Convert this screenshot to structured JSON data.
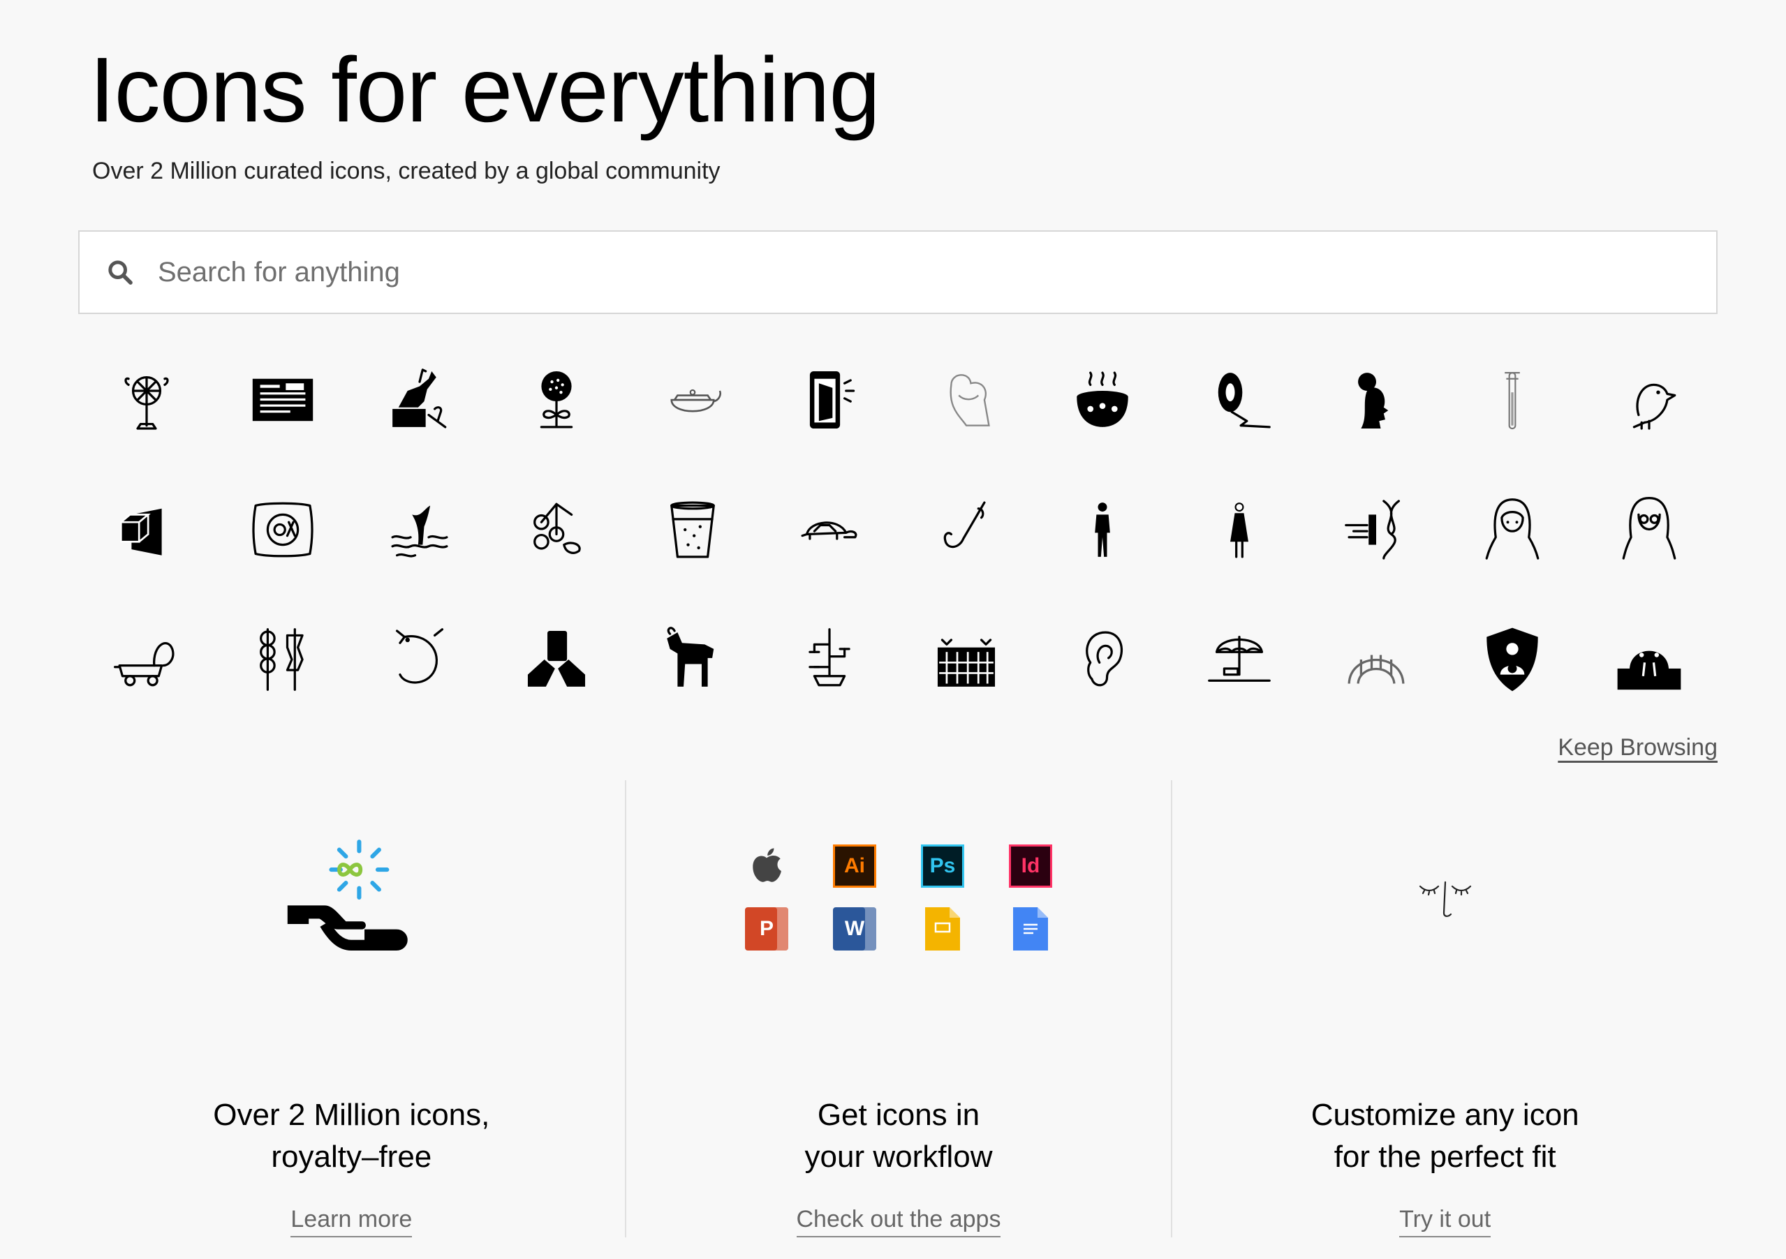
{
  "hero": {
    "title": "Icons for everything",
    "subtitle": "Over 2 Million curated icons, created by a global community"
  },
  "search": {
    "placeholder": "Search for anything",
    "icon": "search-icon"
  },
  "icon_grid": [
    "fan-icon",
    "newspaper-icon",
    "equestrian-statue-icon",
    "sunflower-icon",
    "teapot-icon",
    "phone-door-icon",
    "hug-icon",
    "cauldron-icon",
    "film-reel-icon",
    "woman-profile-icon",
    "thermometer-icon",
    "puffin-icon",
    "box-vr-icon",
    "embroidery-icon",
    "whale-tail-icon",
    "berries-icon",
    "glass-water-icon",
    "turtle-icon",
    "fishing-hook-icon",
    "man-standing-icon",
    "woman-standing-icon",
    "dna-icon",
    "hijab-woman-icon",
    "woman-glasses-icon",
    "cart-icon",
    "dango-icon",
    "shrimp-icon",
    "phone-hands-icon",
    "goat-icon",
    "bonsai-icon",
    "fence-field-icon",
    "ear-icon",
    "beach-umbrella-icon",
    "bridge-icon",
    "shield-mother-icon",
    "walrus-icon"
  ],
  "keep_browsing": "Keep Browsing",
  "features": [
    {
      "title": "Over 2 Million icons,\nroyalty–free",
      "link": "Learn more",
      "icon": "hand-infinity-icon"
    },
    {
      "title": "Get icons in\nyour workflow",
      "link": "Check out the apps",
      "apps": [
        {
          "name": "apple-icon",
          "label": ""
        },
        {
          "name": "illustrator-icon",
          "label": "Ai",
          "fg": "#ff7c00",
          "bg": "#2a1300",
          "border": "#ff7c00"
        },
        {
          "name": "photoshop-icon",
          "label": "Ps",
          "fg": "#31c5f0",
          "bg": "#001d26",
          "border": "#31c5f0"
        },
        {
          "name": "indesign-icon",
          "label": "Id",
          "fg": "#ff3366",
          "bg": "#2b0010",
          "border": "#ff3366"
        },
        {
          "name": "powerpoint-icon",
          "label": "P",
          "fg": "#ffffff",
          "bg": "#d24726"
        },
        {
          "name": "word-icon",
          "label": "W",
          "fg": "#ffffff",
          "bg": "#2b579a"
        },
        {
          "name": "google-slides-icon",
          "label": "",
          "bg": "#f4b400"
        },
        {
          "name": "google-docs-icon",
          "label": "",
          "bg": "#4285f4"
        }
      ]
    },
    {
      "title": "Customize any icon\nfor the perfect fit",
      "link": "Try it out",
      "icon": "face-line-icon"
    }
  ]
}
